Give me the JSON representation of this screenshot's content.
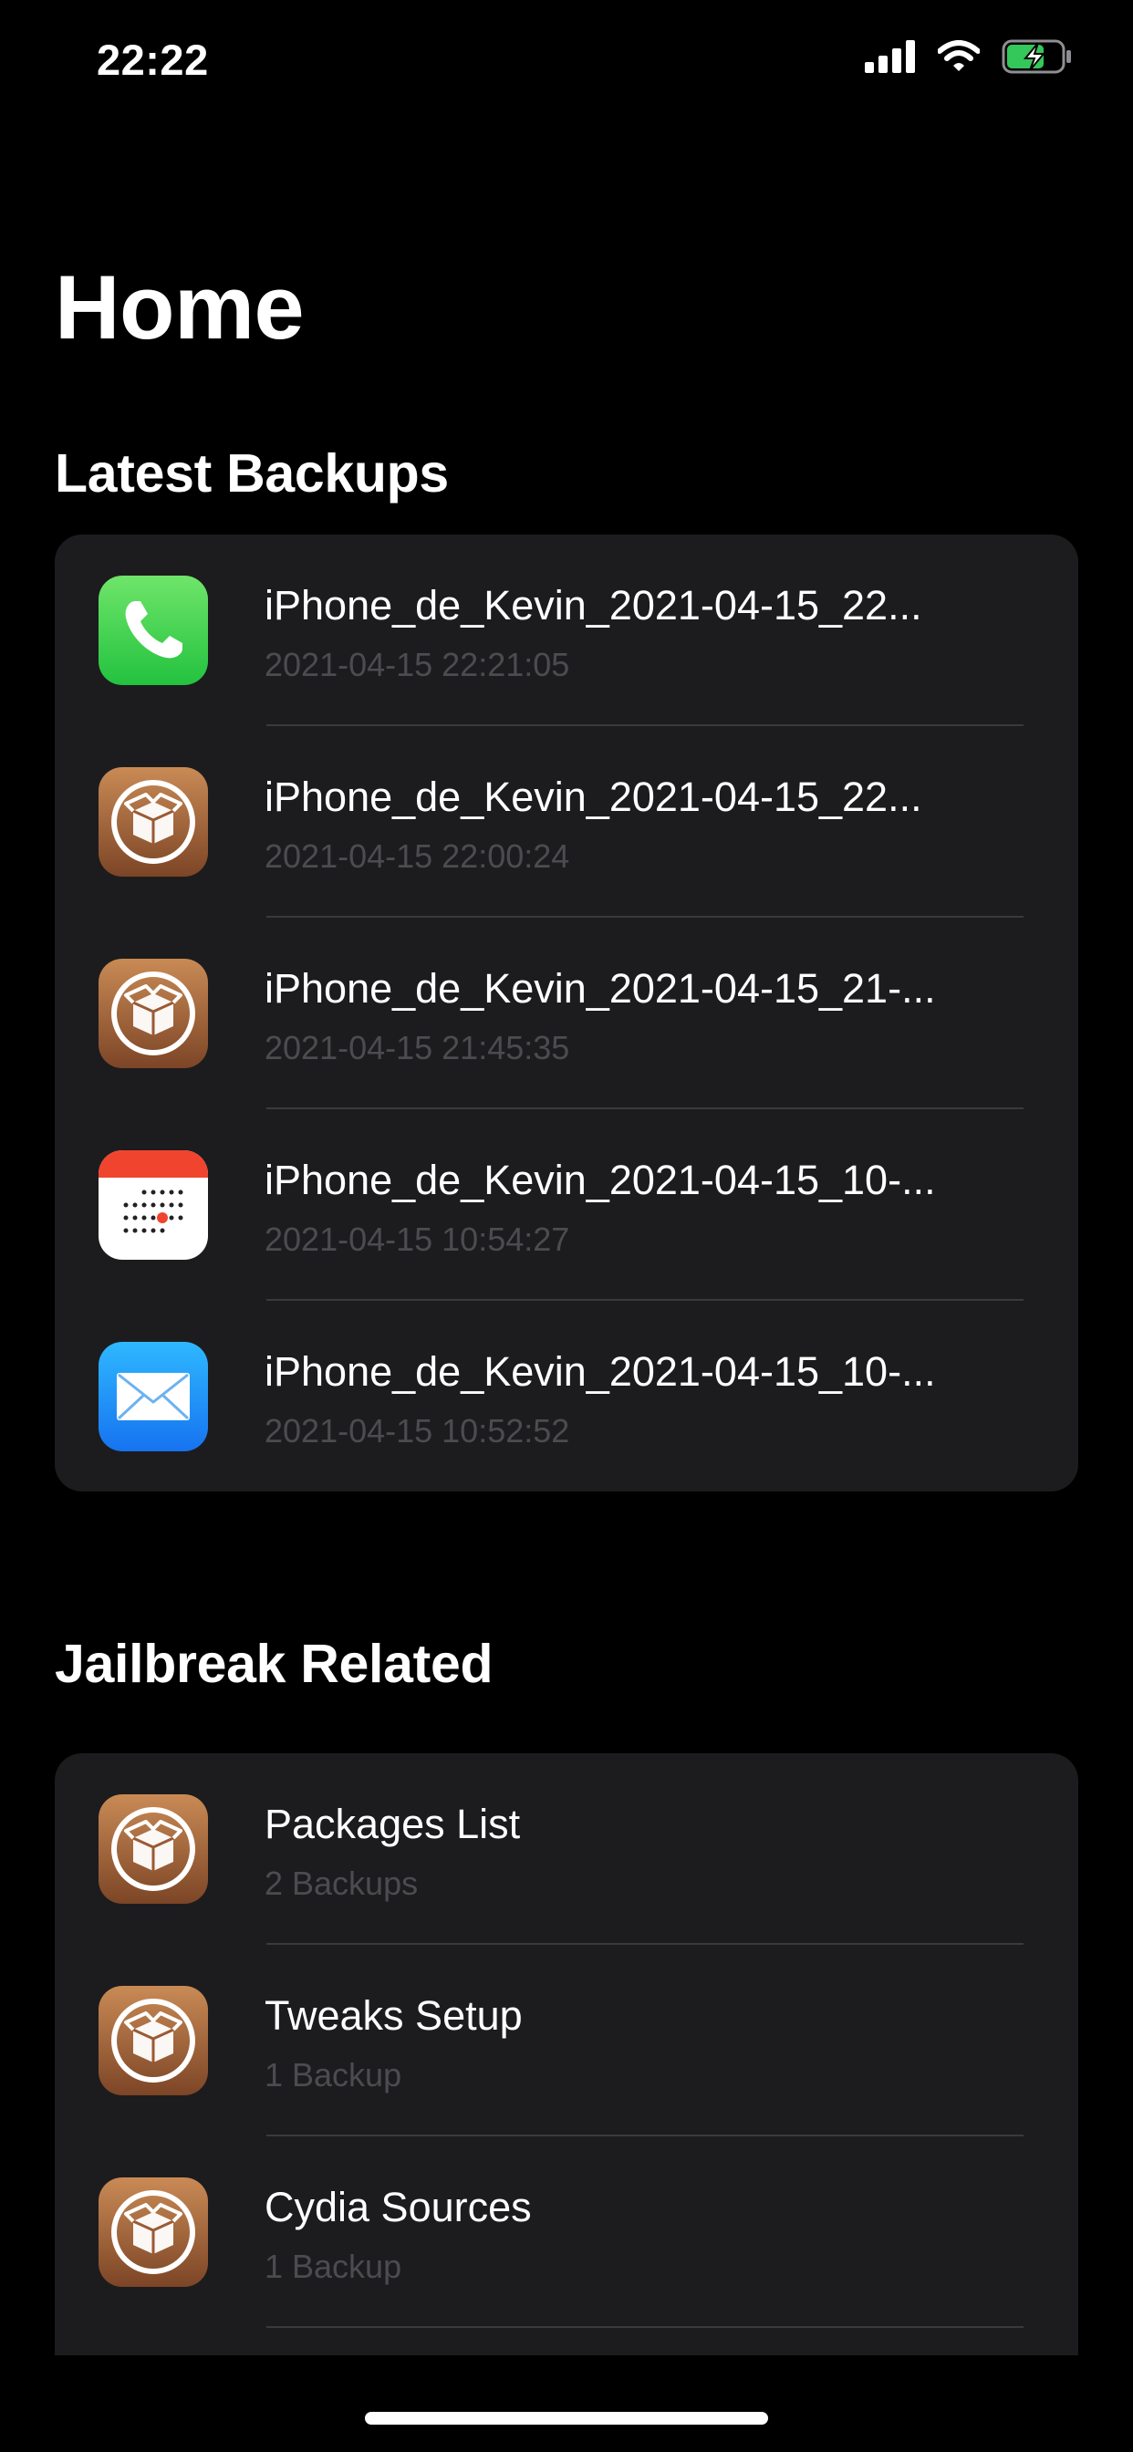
{
  "status_bar": {
    "time": "22:22",
    "icons": [
      "cellular-signal-icon",
      "wifi-icon",
      "battery-charging-icon"
    ],
    "battery_color": "#34c759"
  },
  "page": {
    "title": "Home"
  },
  "latest_backups": {
    "title": "Latest Backups",
    "items": [
      {
        "icon": "phone-icon",
        "title": "iPhone_de_Kevin_2021-04-15_22...",
        "subtitle": "2021-04-15 22:21:05"
      },
      {
        "icon": "cydia-icon",
        "title": "iPhone_de_Kevin_2021-04-15_22...",
        "subtitle": "2021-04-15 22:00:24"
      },
      {
        "icon": "cydia-icon",
        "title": "iPhone_de_Kevin_2021-04-15_21-...",
        "subtitle": "2021-04-15 21:45:35"
      },
      {
        "icon": "calendar-icon",
        "title": "iPhone_de_Kevin_2021-04-15_10-...",
        "subtitle": "2021-04-15 10:54:27"
      },
      {
        "icon": "mail-icon",
        "title": "iPhone_de_Kevin_2021-04-15_10-...",
        "subtitle": "2021-04-15 10:52:52"
      }
    ]
  },
  "jailbreak_related": {
    "title": "Jailbreak Related",
    "items": [
      {
        "icon": "cydia-icon",
        "title": "Packages List",
        "subtitle": "2 Backups"
      },
      {
        "icon": "cydia-icon",
        "title": "Tweaks Setup",
        "subtitle": "1 Backup"
      },
      {
        "icon": "cydia-icon",
        "title": "Cydia Sources",
        "subtitle": "1 Backup"
      }
    ]
  },
  "colors": {
    "background": "#000000",
    "card": "#1c1c1e",
    "separator": "#3a3a3c",
    "subtitle": "#4c4c50",
    "phone_green": "#4cd964",
    "mail_blue": "#1a8cff",
    "cydia_brown": "#a8663a",
    "calendar_red": "#f0442f"
  }
}
